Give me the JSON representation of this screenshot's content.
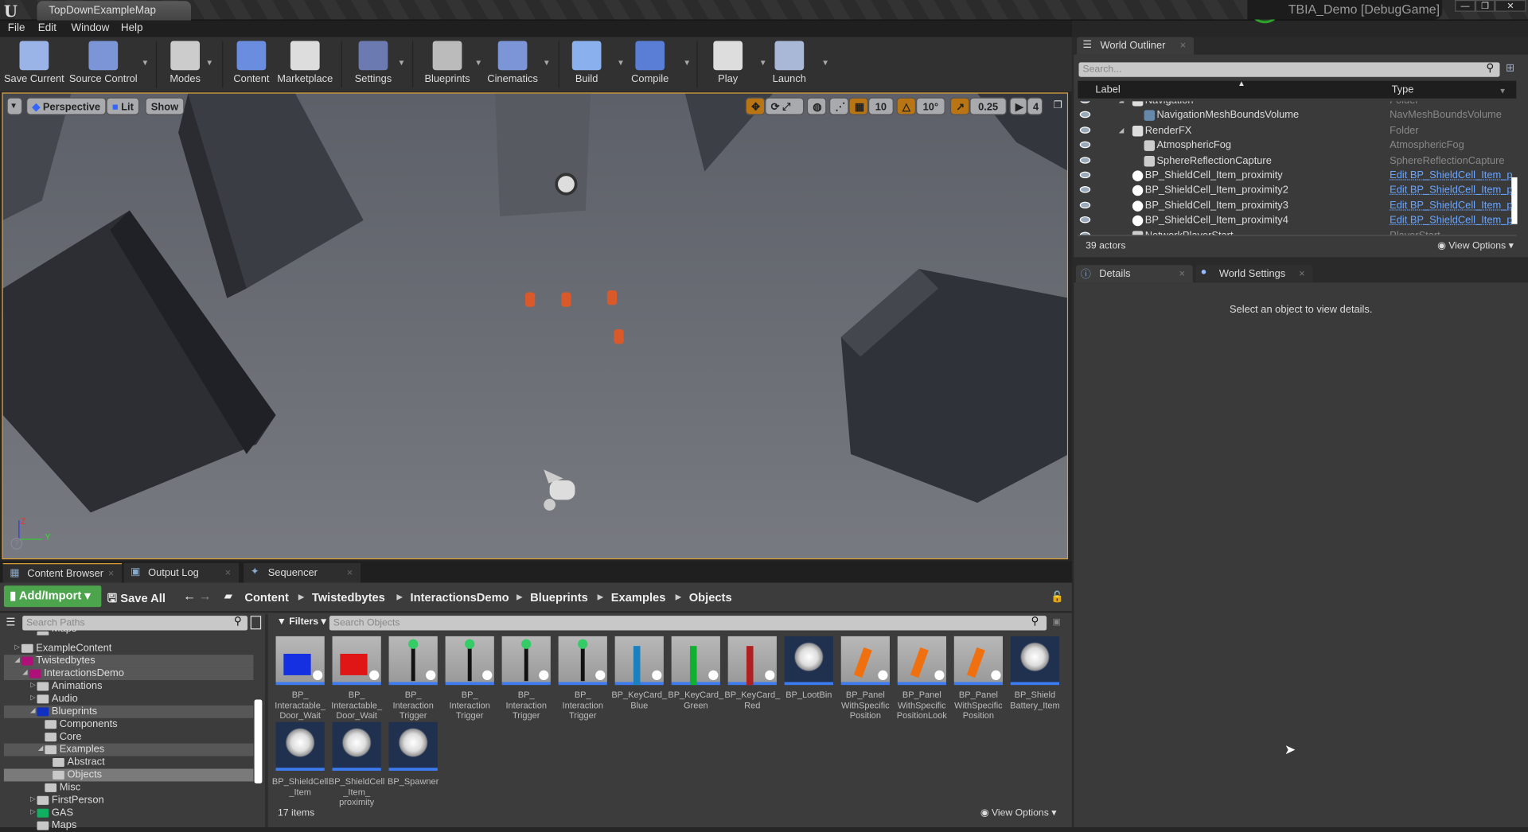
{
  "window": {
    "tab_title": "TopDownExampleMap",
    "project_title": "TBIA_Demo [DebugGame]",
    "minimize": "—",
    "restore": "❐",
    "close": "✕"
  },
  "menu": [
    "File",
    "Edit",
    "Window",
    "Help"
  ],
  "toolbar": [
    {
      "label": "Save Current",
      "icon": "save-icon"
    },
    {
      "label": "Source Control",
      "icon": "source-control-icon"
    },
    {
      "label": "Modes",
      "icon": "modes-icon"
    },
    {
      "label": "Content",
      "icon": "content-icon"
    },
    {
      "label": "Marketplace",
      "icon": "marketplace-icon"
    },
    {
      "label": "Settings",
      "icon": "settings-icon"
    },
    {
      "label": "Blueprints",
      "icon": "blueprints-icon"
    },
    {
      "label": "Cinematics",
      "icon": "cinematics-icon"
    },
    {
      "label": "Build",
      "icon": "build-icon"
    },
    {
      "label": "Compile",
      "icon": "compile-icon"
    },
    {
      "label": "Play",
      "icon": "play-icon"
    },
    {
      "label": "Launch",
      "icon": "launch-icon"
    }
  ],
  "viewport": {
    "view_mode": "Perspective",
    "lighting": "Lit",
    "show": "Show",
    "grid_snap": "10",
    "rotation_snap": "10°",
    "scale_snap": "0.25",
    "camera_speed": "4",
    "axis_z": "Z",
    "axis_y": "Y",
    "accent": "#e0a030"
  },
  "outliner": {
    "tab": "World Outliner",
    "search_placeholder": "Search...",
    "col_label": "Label",
    "col_type": "Type",
    "rows": [
      {
        "label": "Navigation",
        "type": "Folder",
        "indent": 1,
        "icon": "folder-icon"
      },
      {
        "label": "NavigationMeshBoundsVolume",
        "type": "NavMeshBoundsVolume",
        "indent": 2,
        "icon": "nav-mesh-icon"
      },
      {
        "label": "RenderFX",
        "type": "Folder",
        "indent": 1,
        "icon": "folder-icon"
      },
      {
        "label": "AtmosphericFog",
        "type": "AtmosphericFog",
        "indent": 2,
        "icon": "fog-icon"
      },
      {
        "label": "SphereReflectionCapture",
        "type": "SphereReflectionCapture",
        "indent": 2,
        "icon": "reflection-capture-icon"
      },
      {
        "label": "BP_ShieldCell_Item_proximity",
        "type": "Edit BP_ShieldCell_Item_p",
        "indent": 1,
        "icon": "actor-icon",
        "link": true
      },
      {
        "label": "BP_ShieldCell_Item_proximity2",
        "type": "Edit BP_ShieldCell_Item_p",
        "indent": 1,
        "icon": "actor-icon",
        "link": true
      },
      {
        "label": "BP_ShieldCell_Item_proximity3",
        "type": "Edit BP_ShieldCell_Item_p",
        "indent": 1,
        "icon": "actor-icon",
        "link": true
      },
      {
        "label": "BP_ShieldCell_Item_proximity4",
        "type": "Edit BP_ShieldCell_Item_p",
        "indent": 1,
        "icon": "actor-icon",
        "link": true
      },
      {
        "label": "NetworkPlayerStart",
        "type": "PlayerStart",
        "indent": 1,
        "icon": "player-start-icon"
      }
    ],
    "count": "39 actors",
    "view_options": "View Options"
  },
  "details": {
    "tab": "Details",
    "tab2": "World Settings",
    "empty": "Select an object to view details."
  },
  "bottom_tabs": [
    "Content Browser",
    "Output Log",
    "Sequencer"
  ],
  "content_browser": {
    "add_import": "Add/Import",
    "save_all": "Save All",
    "breadcrumb": [
      "Content",
      "Twistedbytes",
      "InteractionsDemo",
      "Blueprints",
      "Examples",
      "Objects"
    ],
    "search_paths_placeholder": "Search Paths",
    "filters": "Filters",
    "search_objects_placeholder": "Search Objects",
    "tree": [
      {
        "label": "Maps",
        "level": 2,
        "color": "#c8c8c8",
        "partial": true
      },
      {
        "label": "ExampleContent",
        "level": 0,
        "color": "#c8c8c8",
        "arrow": "▷"
      },
      {
        "label": "Twistedbytes",
        "level": 0,
        "color": "#b0107a",
        "arrow": "◢",
        "state": "sel"
      },
      {
        "label": "InteractionsDemo",
        "level": 1,
        "color": "#b0107a",
        "arrow": "◢",
        "state": "sel"
      },
      {
        "label": "Animations",
        "level": 2,
        "color": "#c8c8c8",
        "arrow": "▷"
      },
      {
        "label": "Audio",
        "level": 2,
        "color": "#c8c8c8",
        "arrow": "▷"
      },
      {
        "label": "Blueprints",
        "level": 2,
        "color": "#1030c0",
        "arrow": "◢",
        "state": "sel"
      },
      {
        "label": "Components",
        "level": 3,
        "color": "#c8c8c8"
      },
      {
        "label": "Core",
        "level": 3,
        "color": "#c8c8c8"
      },
      {
        "label": "Examples",
        "level": 3,
        "color": "#c8c8c8",
        "arrow": "◢",
        "state": "sel"
      },
      {
        "label": "Abstract",
        "level": 4,
        "color": "#c8c8c8"
      },
      {
        "label": "Objects",
        "level": 4,
        "color": "#c8c8c8",
        "state": "cur"
      },
      {
        "label": "Misc",
        "level": 3,
        "color": "#c8c8c8"
      },
      {
        "label": "FirstPerson",
        "level": 2,
        "color": "#c8c8c8",
        "arrow": "▷"
      },
      {
        "label": "GAS",
        "level": 2,
        "color": "#10b060",
        "arrow": "▷"
      },
      {
        "label": "Maps",
        "level": 2,
        "color": "#c8c8c8"
      }
    ],
    "assets": [
      {
        "label": "BP_ Interactable_ Door_Wait",
        "thumb": "blue-panel"
      },
      {
        "label": "BP_ Interactable_ Door_Wait",
        "thumb": "red-panel"
      },
      {
        "label": "BP_ Interaction Trigger",
        "thumb": "trigger"
      },
      {
        "label": "BP_ Interaction Trigger",
        "thumb": "trigger"
      },
      {
        "label": "BP_ Interaction Trigger",
        "thumb": "trigger"
      },
      {
        "label": "BP_ Interaction Trigger",
        "thumb": "trigger"
      },
      {
        "label": "BP_KeyCard_ Blue",
        "thumb": "keycard-blue"
      },
      {
        "label": "BP_KeyCard_ Green",
        "thumb": "keycard-green"
      },
      {
        "label": "BP_KeyCard_ Red",
        "thumb": "keycard-red"
      },
      {
        "label": "BP_LootBin",
        "thumb": "sphere"
      },
      {
        "label": "BP_Panel WithSpecific Position",
        "thumb": "panel-arm"
      },
      {
        "label": "BP_Panel WithSpecific PositionLook",
        "thumb": "panel-arm"
      },
      {
        "label": "BP_Panel WithSpecific Position",
        "thumb": "panel-arm"
      },
      {
        "label": "BP_Shield Battery_Item",
        "thumb": "sphere"
      },
      {
        "label": "BP_ShieldCell _Item",
        "thumb": "sphere"
      },
      {
        "label": "BP_ShieldCell _Item_ proximity",
        "thumb": "sphere"
      },
      {
        "label": "BP_Spawner",
        "thumb": "sphere"
      }
    ],
    "count": "17 items",
    "view_options": "View Options"
  }
}
